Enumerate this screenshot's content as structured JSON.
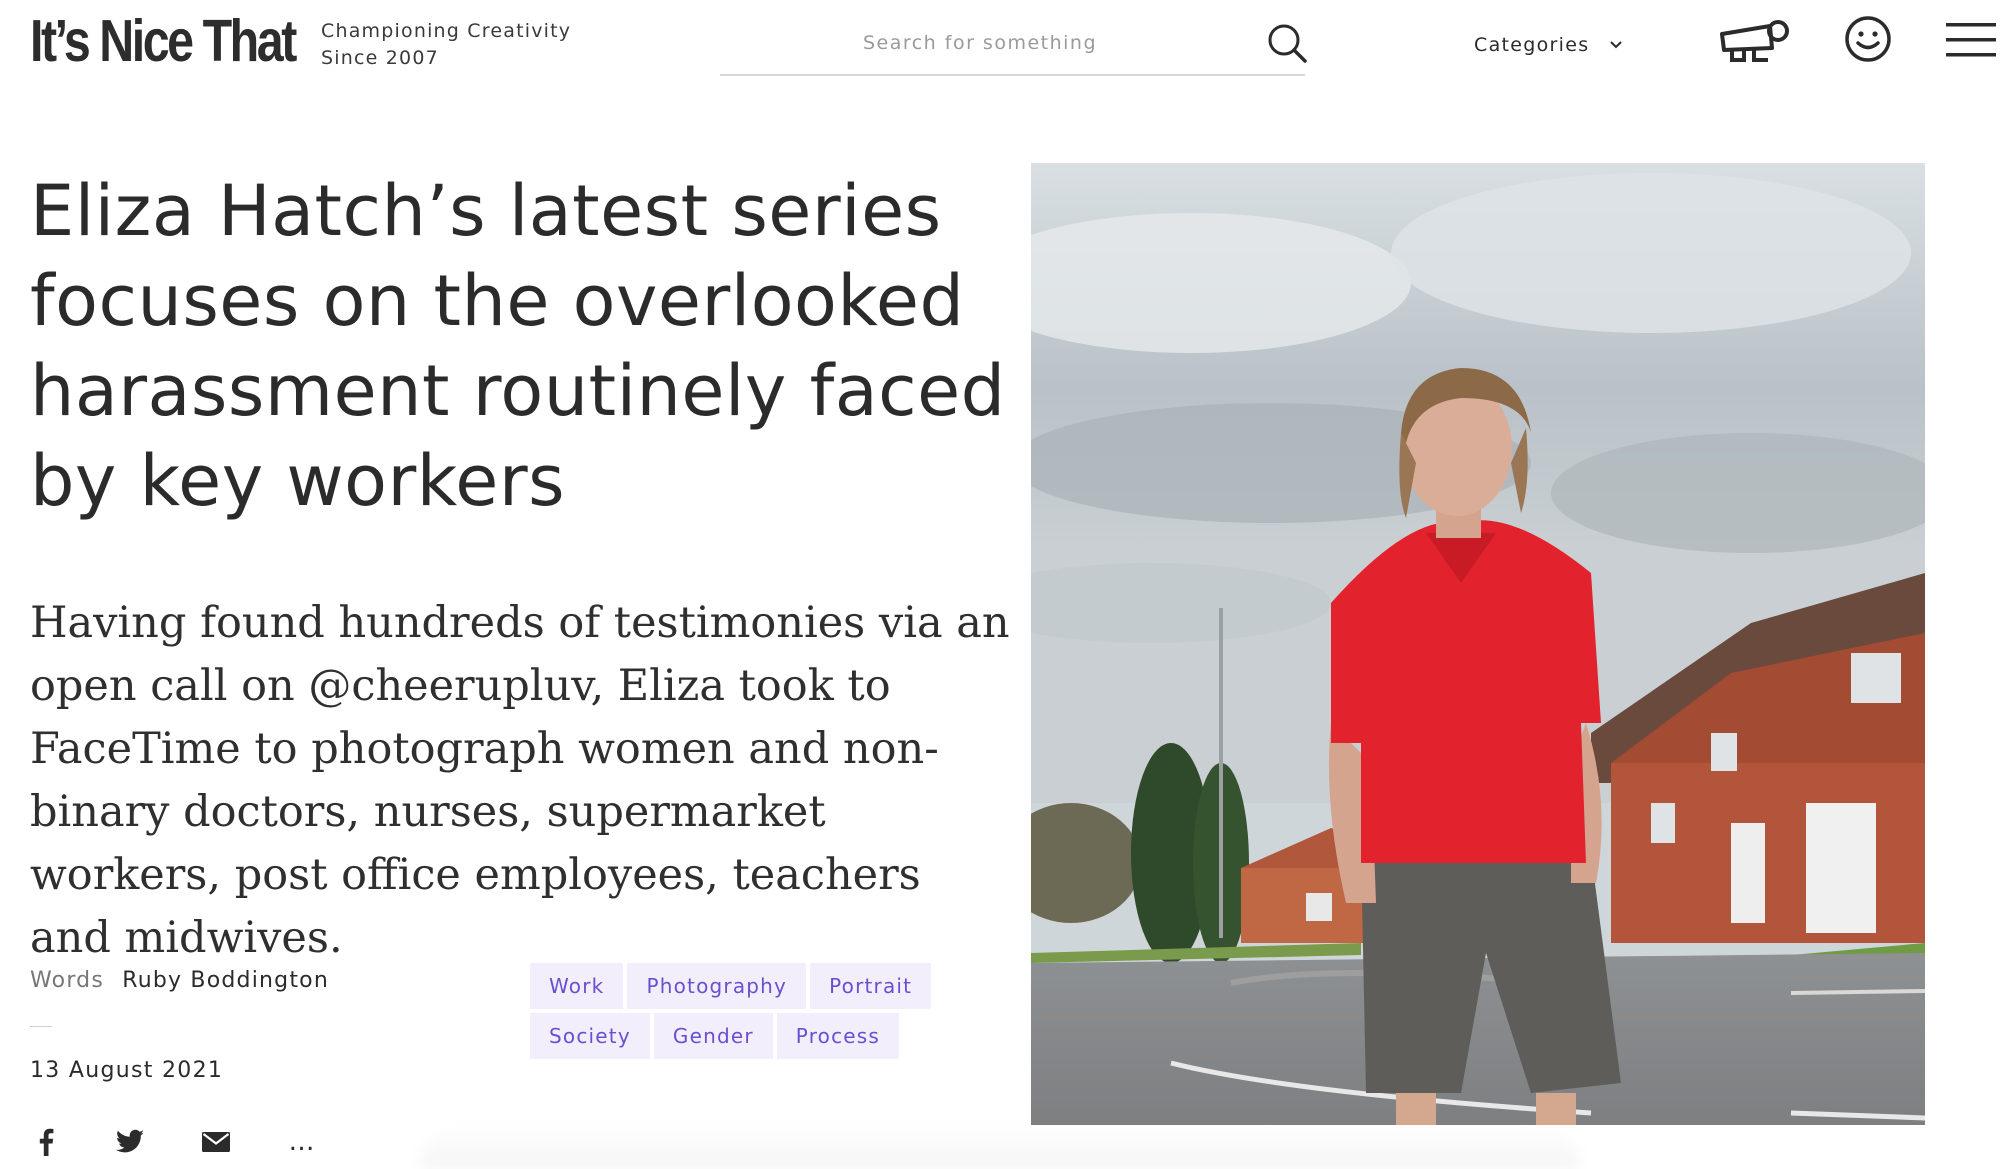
{
  "header": {
    "logo": "It’s Nice That",
    "tagline_line1": "Championing Creativity",
    "tagline_line2": "Since 2007",
    "search_placeholder": "Search for something",
    "categories_label": "Categories"
  },
  "article": {
    "headline": "Eliza Hatch’s latest series focuses on the overlooked harassment routinely faced by key workers",
    "standfirst": "Having found hundreds of testimonies via an open call on @cheerupluv, Eliza took to FaceTime to photograph women and non-binary doctors, nurses, supermarket workers, post office employees, teachers and midwives.",
    "words_label": "Words",
    "author": "Ruby Boddington",
    "date": "13 August 2021",
    "tags_row1": [
      "Work",
      "Photography",
      "Portrait"
    ],
    "tags_row2": [
      "Society",
      "Gender",
      "Process"
    ],
    "share_more": "…"
  },
  "icons": {
    "search": "search-icon",
    "categories": "chevron-down-icon",
    "megaphone": "megaphone-icon",
    "account": "smiley-icon",
    "menu": "hamburger-icon",
    "facebook": "facebook-icon",
    "twitter": "twitter-icon",
    "email": "email-icon"
  },
  "colors": {
    "text": "#2b2b2b",
    "tag_background": "#f2eefb",
    "tag_text": "#6b4fcf",
    "shirt_red": "#e2222d"
  }
}
